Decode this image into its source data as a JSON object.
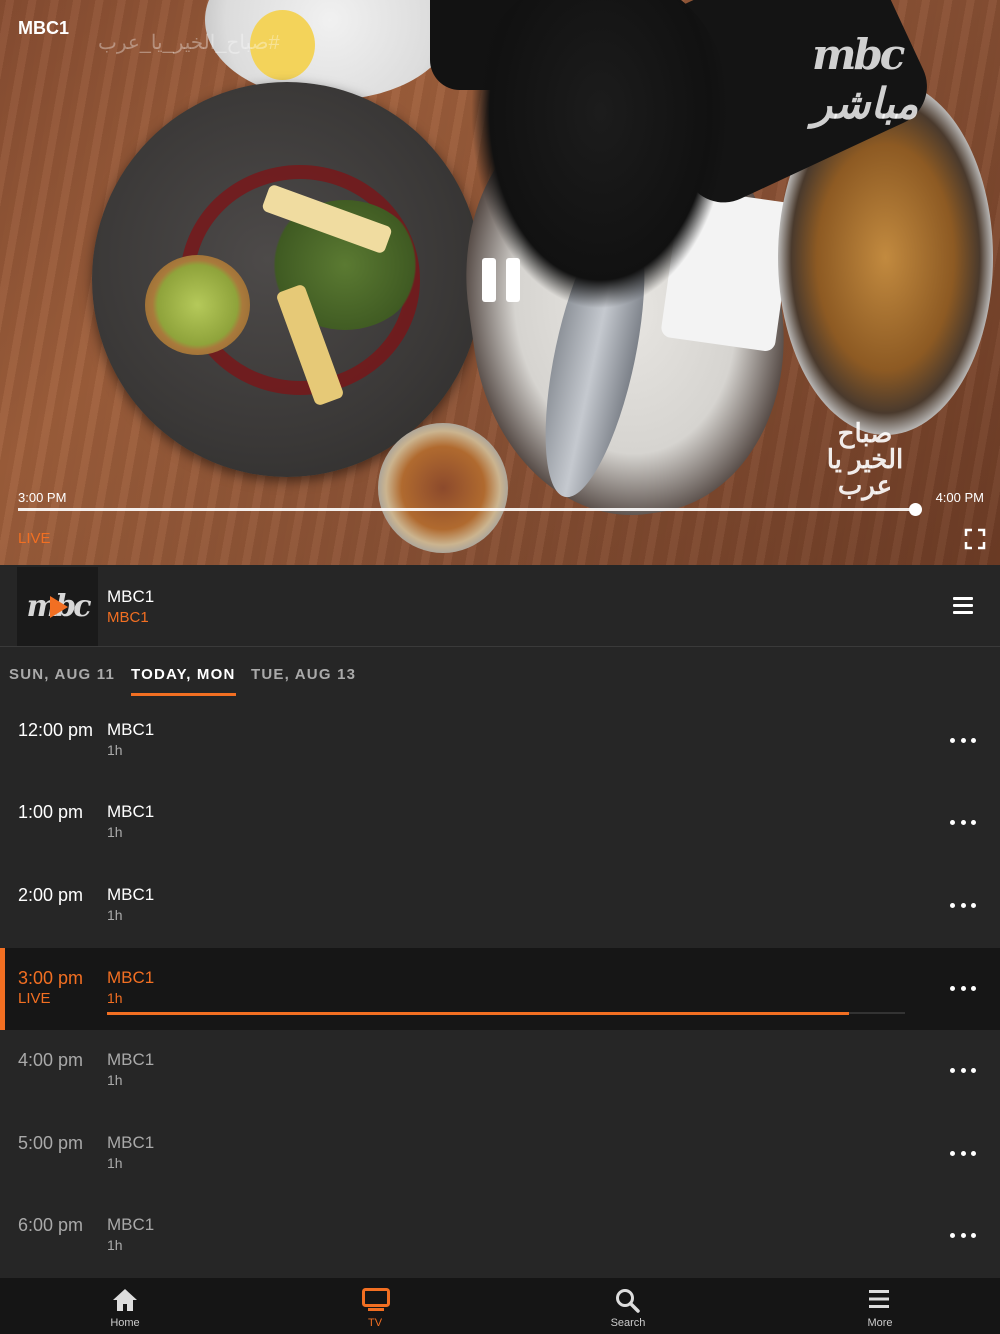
{
  "player": {
    "channel_label": "MBC1",
    "start_time": "3:00 PM",
    "end_time": "4:00 PM",
    "live_label": "LIVE",
    "progress": 0.88,
    "watermark": "mbc مباشر",
    "hashtag": "#صباح_الخير_يا_عرب",
    "show_stamp": "صباح الخير يا عرب"
  },
  "channel": {
    "logo_text": "mbc",
    "name": "MBC1",
    "subtitle": "MBC1"
  },
  "day_tabs": [
    {
      "label": "SUN, AUG 11",
      "active": false
    },
    {
      "label": "TODAY, MON",
      "active": true
    },
    {
      "label": "TUE, AUG 13",
      "active": false
    }
  ],
  "schedule": [
    {
      "time": "12:00 pm",
      "title": "MBC1",
      "duration": "1h",
      "state": "past"
    },
    {
      "time": "1:00 pm",
      "title": "MBC1",
      "duration": "1h",
      "state": "past"
    },
    {
      "time": "2:00 pm",
      "title": "MBC1",
      "duration": "1h",
      "state": "past"
    },
    {
      "time": "3:00 pm",
      "live": "LIVE",
      "title": "MBC1",
      "duration": "1h",
      "state": "current",
      "progress": 0.93
    },
    {
      "time": "4:00 pm",
      "title": "MBC1",
      "duration": "1h",
      "state": "future"
    },
    {
      "time": "5:00 pm",
      "title": "MBC1",
      "duration": "1h",
      "state": "future"
    },
    {
      "time": "6:00 pm",
      "title": "MBC1",
      "duration": "1h",
      "state": "future"
    }
  ],
  "nav": [
    {
      "label": "Home",
      "icon": "home-icon",
      "active": false
    },
    {
      "label": "TV",
      "icon": "tv-icon",
      "active": true
    },
    {
      "label": "Search",
      "icon": "search-icon",
      "active": false
    },
    {
      "label": "More",
      "icon": "menu-icon",
      "active": false
    }
  ],
  "colors": {
    "accent": "#f26f22",
    "background": "#262626",
    "nav_bg": "#151515"
  }
}
